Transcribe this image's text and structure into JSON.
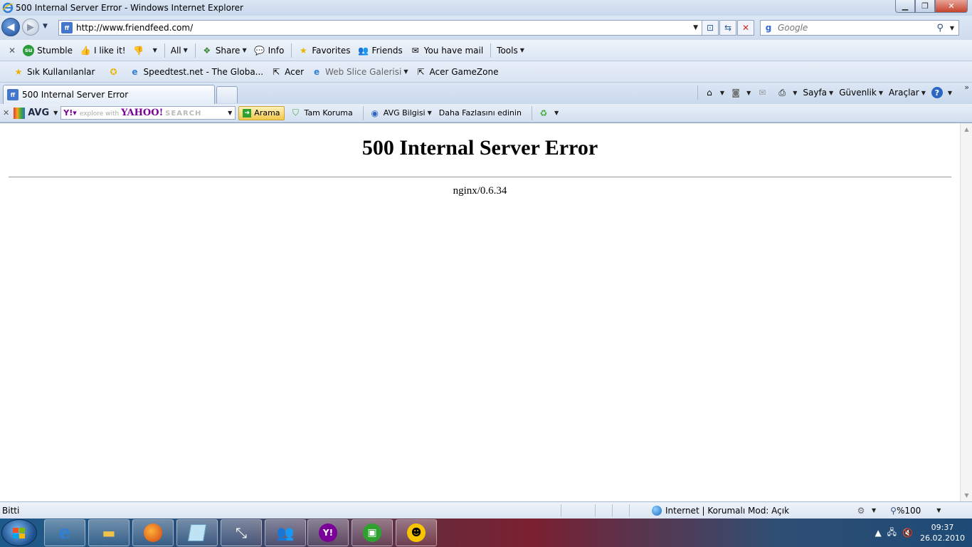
{
  "window": {
    "title": "500 Internal Server Error - Windows Internet Explorer"
  },
  "address": {
    "url": "http://www.friendfeed.com/",
    "search_placeholder": "Google"
  },
  "toolbar1": {
    "stumble": "Stumble",
    "ilike": "I like it!",
    "all": "All",
    "share": "Share",
    "info": "Info",
    "favorites": "Favorites",
    "friends": "Friends",
    "mail": "You have mail",
    "tools": "Tools"
  },
  "favorites_bar": {
    "favorites_label": "Sık Kullanılanlar",
    "links": [
      "Speedtest.net - The Globa...",
      "Acer",
      "Web Slice Galerisi",
      "Acer GameZone"
    ]
  },
  "tabs": {
    "active": "500 Internal Server Error"
  },
  "command_bar": {
    "page": "Sayfa",
    "safety": "Güvenlik",
    "tools": "Araçlar"
  },
  "avg_bar": {
    "brand": "AVG",
    "yahoo_hint": "explore with",
    "yahoo_brand": "YAHOO!",
    "yahoo_search": "SEARCH",
    "search_button": "Arama",
    "protection": "Tam Koruma",
    "info": "AVG Bilgisi",
    "more": "Daha Fazlasını edinin"
  },
  "page": {
    "heading": "500 Internal Server Error",
    "server": "nginx/0.6.34"
  },
  "status": {
    "done": "Bitti",
    "zone": "Internet | Korumalı Mod: Açık",
    "zoom": "%100"
  },
  "taskbar": {
    "time": "09:37",
    "date": "26.02.2010"
  }
}
